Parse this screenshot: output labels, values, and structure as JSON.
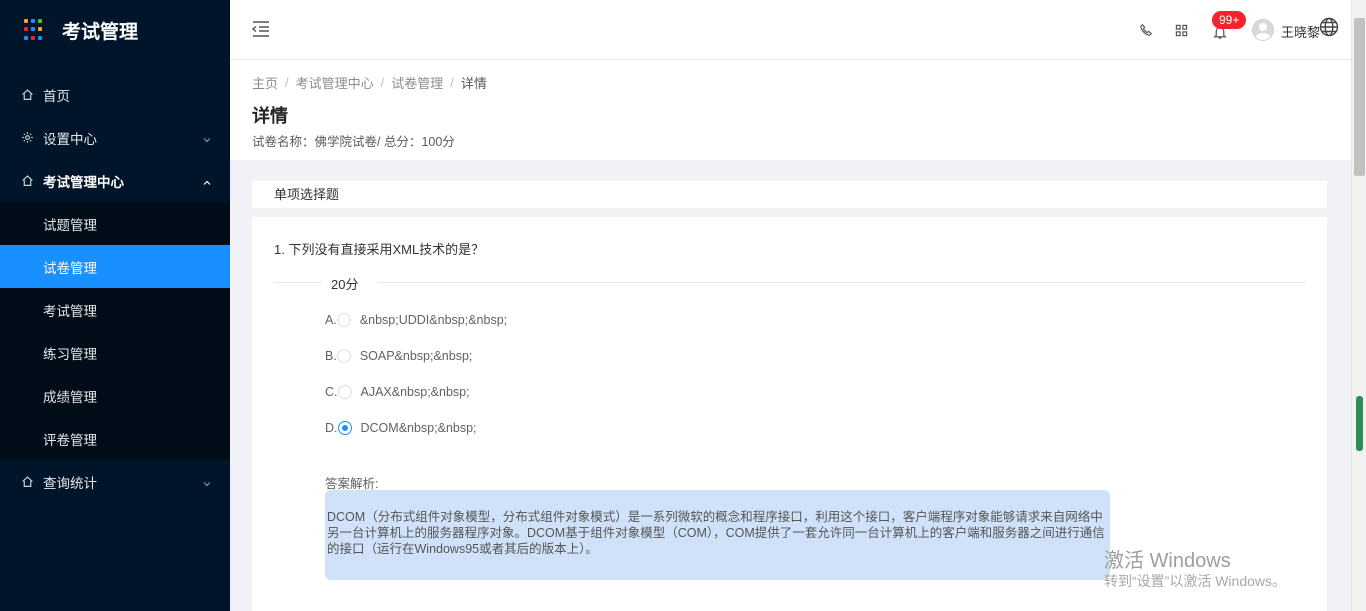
{
  "app": {
    "title": "考试管理",
    "logo_colors": [
      "#f5a623",
      "#1890ff",
      "#52c41a",
      "#f5222d",
      "#1890ff",
      "#f5a623",
      "#1890ff",
      "#f5222d",
      "#1890ff"
    ]
  },
  "sidebar": {
    "items": [
      {
        "label": "首页",
        "icon": "home-icon"
      },
      {
        "label": "设置中心",
        "icon": "gear-icon"
      },
      {
        "label": "考试管理中心",
        "icon": "home-icon"
      },
      {
        "label": "查询统计",
        "icon": "home-icon"
      }
    ],
    "submenu": [
      {
        "label": "试题管理"
      },
      {
        "label": "试卷管理"
      },
      {
        "label": "考试管理"
      },
      {
        "label": "练习管理"
      },
      {
        "label": "成绩管理"
      },
      {
        "label": "评卷管理"
      }
    ]
  },
  "header": {
    "badge": "99+",
    "username": "王晓黎",
    "icons": [
      "menu-fold-icon",
      "phone-icon",
      "apps-icon",
      "bell-icon",
      "globe-icon"
    ]
  },
  "breadcrumb": {
    "items": [
      "主页",
      "考试管理中心",
      "试卷管理"
    ],
    "current": "详情",
    "separator": "/"
  },
  "page": {
    "title": "详情",
    "subtitle": "试卷名称：佛学院试卷/ 总分：100分"
  },
  "section": {
    "title": "单项选择题"
  },
  "question": {
    "title": "1. 下列没有直接采用XML技术的是？",
    "score": "20分",
    "options": [
      {
        "letter": "A.",
        "text": "&nbsp;UDDI&nbsp;&nbsp;"
      },
      {
        "letter": "B.",
        "text": "SOAP&nbsp;&nbsp;"
      },
      {
        "letter": "C.",
        "text": "AJAX&nbsp;&nbsp;"
      },
      {
        "letter": "D.",
        "text": "DCOM&nbsp;&nbsp;"
      }
    ],
    "selected": "D.",
    "analysis_label": "答案解析:",
    "analysis_text": "DCOM（分布式组件对象模型，分布式组件对象模式）是一系列微软的概念和程序接口，利用这个接口，客户端程序对象能够请求来自网络中另一台计算机上的服务器程序对象。DCOM基于组件对象模型（COM），COM提供了一套允许同一台计算机上的客户端和服务器之间进行通信的接口（运行在Windows95或者其后的版本上）。"
  },
  "watermark": {
    "title": "激活 Windows",
    "subtitle": "转到“设置”以激活 Windows。"
  }
}
